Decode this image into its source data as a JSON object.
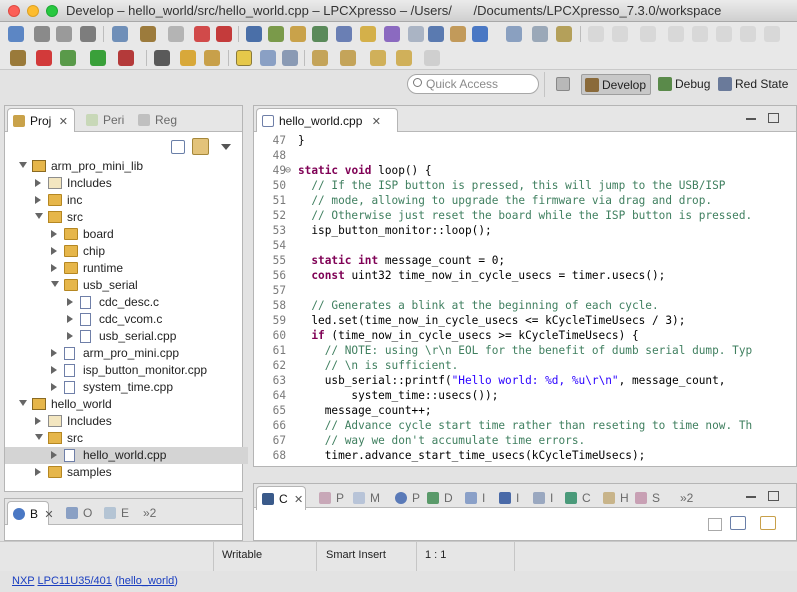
{
  "window": {
    "title": "Develop – hello_world/src/hello_world.cpp – LPCXpresso – /Users/      /Documents/LPCXpresso_7.3.0/workspace"
  },
  "toolbar": {
    "quick_access_placeholder": "Quick Access"
  },
  "perspectives": [
    {
      "label": "Develop",
      "active": true
    },
    {
      "label": "Debug",
      "active": false
    },
    {
      "label": "Red State",
      "active": false
    }
  ],
  "left_panel": {
    "tabs": [
      {
        "label": "Proj",
        "selected": true
      },
      {
        "label": "Peri",
        "selected": false
      },
      {
        "label": "Reg",
        "selected": false
      }
    ],
    "tree": [
      {
        "label": "arm_pro_mini_lib",
        "depth": 0,
        "kind": "project",
        "expand": "open"
      },
      {
        "label": "Includes",
        "depth": 1,
        "kind": "includes",
        "expand": "closed"
      },
      {
        "label": "inc",
        "depth": 1,
        "kind": "folder",
        "expand": "closed"
      },
      {
        "label": "src",
        "depth": 1,
        "kind": "srcfolder",
        "expand": "open"
      },
      {
        "label": "board",
        "depth": 2,
        "kind": "folder",
        "expand": "closed"
      },
      {
        "label": "chip",
        "depth": 2,
        "kind": "folder",
        "expand": "closed"
      },
      {
        "label": "runtime",
        "depth": 2,
        "kind": "folder",
        "expand": "closed"
      },
      {
        "label": "usb_serial",
        "depth": 2,
        "kind": "folder",
        "expand": "open"
      },
      {
        "label": "cdc_desc.c",
        "depth": 3,
        "kind": "file",
        "expand": "closed"
      },
      {
        "label": "cdc_vcom.c",
        "depth": 3,
        "kind": "file",
        "expand": "closed"
      },
      {
        "label": "usb_serial.cpp",
        "depth": 3,
        "kind": "file",
        "expand": "closed"
      },
      {
        "label": "arm_pro_mini.cpp",
        "depth": 2,
        "kind": "file",
        "expand": "closed"
      },
      {
        "label": "isp_button_monitor.cpp",
        "depth": 2,
        "kind": "file",
        "expand": "closed"
      },
      {
        "label": "system_time.cpp",
        "depth": 2,
        "kind": "file",
        "expand": "closed"
      },
      {
        "label": "hello_world",
        "depth": 0,
        "kind": "project",
        "expand": "open"
      },
      {
        "label": "Includes",
        "depth": 1,
        "kind": "includes",
        "expand": "closed"
      },
      {
        "label": "src",
        "depth": 1,
        "kind": "srcfolder",
        "expand": "open"
      },
      {
        "label": "hello_world.cpp",
        "depth": 2,
        "kind": "file",
        "expand": "closed",
        "selected": true
      },
      {
        "label": "samples",
        "depth": 1,
        "kind": "folder",
        "expand": "closed"
      }
    ]
  },
  "editor": {
    "tab_label": "hello_world.cpp",
    "lines": [
      {
        "num": "47",
        "text": "}"
      },
      {
        "num": "48",
        "text": ""
      },
      {
        "num": "49",
        "text": "static void loop() {",
        "fold": "⊖"
      },
      {
        "num": "50",
        "text": "  // If the ISP button is pressed, this will jump to the USB/ISP"
      },
      {
        "num": "51",
        "text": "  // mode, allowing to upgrade the firmware via drag and drop."
      },
      {
        "num": "52",
        "text": "  // Otherwise just reset the board while the ISP button is pressed."
      },
      {
        "num": "53",
        "text": "  isp_button_monitor::loop();"
      },
      {
        "num": "54",
        "text": ""
      },
      {
        "num": "55",
        "text": "  static int message_count = 0;"
      },
      {
        "num": "56",
        "text": "  const uint32 time_now_in_cycle_usecs = timer.usecs();"
      },
      {
        "num": "57",
        "text": ""
      },
      {
        "num": "58",
        "text": "  // Generates a blink at the beginning of each cycle."
      },
      {
        "num": "59",
        "text": "  led.set(time_now_in_cycle_usecs <= kCycleTimeUsecs / 3);"
      },
      {
        "num": "60",
        "text": "  if (time_now_in_cycle_usecs >= kCycleTimeUsecs) {"
      },
      {
        "num": "61",
        "text": "    // NOTE: using \\r\\n EOL for the benefit of dumb serial dump. Typ"
      },
      {
        "num": "62",
        "text": "    // \\n is sufficient."
      },
      {
        "num": "63",
        "text": "    usb_serial::printf(\"Hello world: %d, %u\\r\\n\", message_count,"
      },
      {
        "num": "64",
        "text": "        system_time::usecs());"
      },
      {
        "num": "65",
        "text": "    message_count++;"
      },
      {
        "num": "66",
        "text": "    // Advance cycle start time rather than reseting to time now. Th"
      },
      {
        "num": "67",
        "text": "    // way we don't accumulate time errors."
      },
      {
        "num": "68",
        "text": "    timer.advance_start_time_usecs(kCycleTimeUsecs);"
      }
    ]
  },
  "bottom_right_panel": {
    "tabs": [
      {
        "label": "C",
        "selected": true
      },
      {
        "label": "P",
        "selected": false
      },
      {
        "label": "M",
        "selected": false
      },
      {
        "label": "P",
        "selected": false
      },
      {
        "label": "D",
        "selected": false
      },
      {
        "label": "I",
        "selected": false
      },
      {
        "label": "I",
        "selected": false
      },
      {
        "label": "I",
        "selected": false
      },
      {
        "label": "C",
        "selected": false
      },
      {
        "label": "H",
        "selected": false
      },
      {
        "label": "S",
        "selected": false
      }
    ],
    "overflow": "»2"
  },
  "bottom_left_panel": {
    "tabs": [
      {
        "label": "B",
        "selected": true
      },
      {
        "label": "O",
        "selected": false
      },
      {
        "label": "E",
        "selected": false
      }
    ],
    "overflow": "»2"
  },
  "status": {
    "mode": "Writable",
    "insert": "Smart Insert",
    "position": "1 : 1"
  },
  "footer": {
    "vendor": "NXP",
    "device": "LPC11U35/401",
    "project_open": "(",
    "project": "hello_world",
    "project_close": ")"
  },
  "colors": {
    "keyword": "#7f0055",
    "comment": "#3f7f5f",
    "string": "#2a00ff",
    "folder": "#e6b64a",
    "selection": "#d4d4d4"
  }
}
